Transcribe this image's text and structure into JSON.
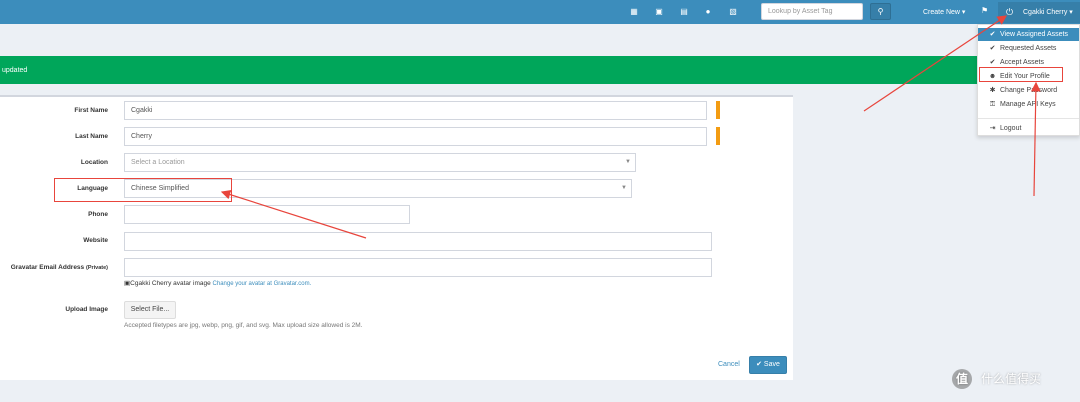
{
  "topbar": {
    "icons": [
      "barcode-icon",
      "license-icon",
      "keyboard-icon",
      "tint-icon",
      "server-icon"
    ],
    "search_placeholder": "Lookup by Asset Tag",
    "search_icon": "search-icon",
    "create_new_label": "Create New ▾",
    "flag_icon": "flag-icon",
    "user_name": "Cgakki Cherry ▾",
    "colors": {
      "bar": "#3c8dbc",
      "user_button": "#367fa9"
    }
  },
  "user_menu": {
    "items": [
      {
        "icon": "✔",
        "label": "View Assigned Assets"
      },
      {
        "icon": "✔",
        "label": "Requested Assets"
      },
      {
        "icon": "✔",
        "label": "Accept Assets"
      },
      {
        "icon": "☻",
        "label": "Edit Your Profile"
      },
      {
        "icon": "✱",
        "label": "Change Password"
      },
      {
        "icon": "⚿",
        "label": "Manage API Keys"
      },
      {
        "icon": "⇥",
        "label": "Logout"
      }
    ]
  },
  "alert": {
    "message": "updated",
    "color": "#00a65a"
  },
  "form": {
    "first_name": {
      "label": "First Name",
      "value": "Cgakki"
    },
    "last_name": {
      "label": "Last Name",
      "value": "Cherry"
    },
    "location": {
      "label": "Location",
      "placeholder": "Select a Location"
    },
    "language": {
      "label": "Language",
      "value": "Chinese Simplified"
    },
    "phone": {
      "label": "Phone",
      "value": ""
    },
    "website": {
      "label": "Website",
      "value": ""
    },
    "gravatar": {
      "label": "Gravatar Email Address",
      "label_suffix": "(Private)",
      "value": ""
    },
    "avatar_alt": "Cgakki Cherry avatar image",
    "avatar_link": "Change your avatar at Gravatar.com.",
    "upload": {
      "label": "Upload Image",
      "button": "Select File...",
      "help": "Accepted filetypes are jpg, webp, png, gif, and svg. Max upload size allowed is 2M."
    },
    "cancel_label": "Cancel",
    "save_label": "✔ Save",
    "required_color": "#f39c12"
  },
  "watermark": {
    "logo": "值",
    "text": "什么值得买"
  }
}
